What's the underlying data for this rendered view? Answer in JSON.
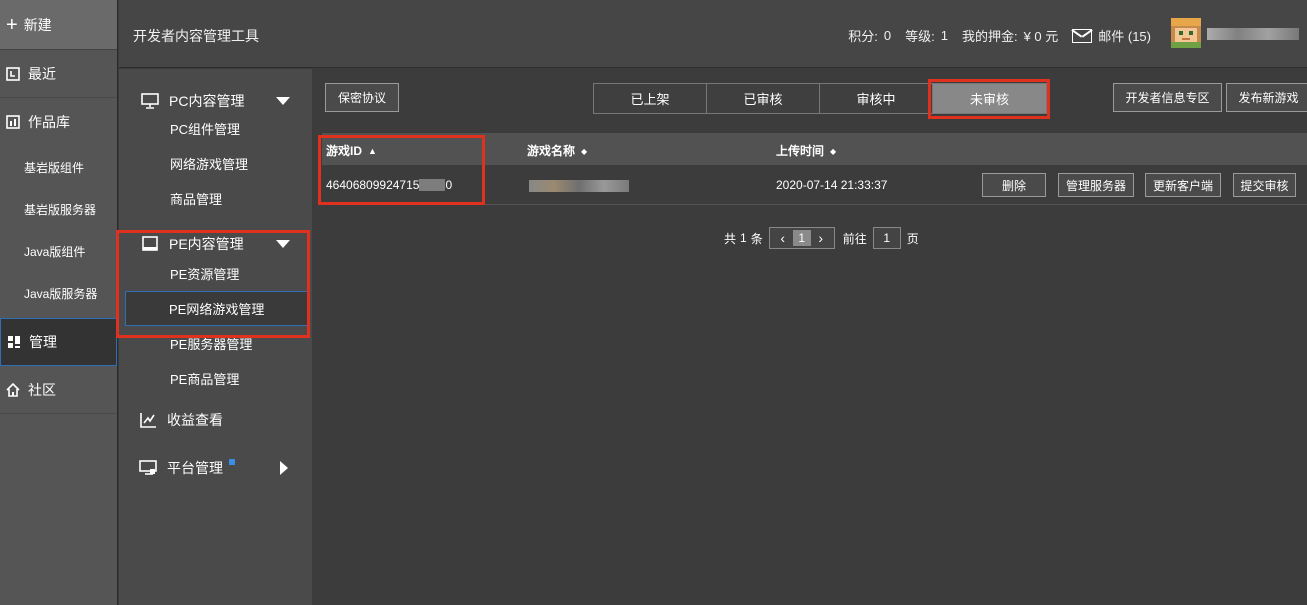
{
  "rail": {
    "new_label": "新建",
    "items": [
      {
        "label": "最近"
      },
      {
        "label": "作品库"
      }
    ],
    "subitems": [
      {
        "label": "基岩版组件"
      },
      {
        "label": "基岩版服务器"
      },
      {
        "label": "Java版组件"
      },
      {
        "label": "Java版服务器"
      }
    ],
    "manage_label": "管理",
    "community_label": "社区"
  },
  "header": {
    "title": "开发者内容管理工具",
    "points_label": "积分:",
    "points_value": "0",
    "level_label": "等级:",
    "level_value": "1",
    "deposit_label": "我的押金:",
    "deposit_value": "¥ 0 元",
    "mail_label": "邮件 (15)"
  },
  "menu": {
    "pc_section": "PC内容管理",
    "pc_items": [
      "PC组件管理",
      "网络游戏管理",
      "商品管理"
    ],
    "pe_section": "PE内容管理",
    "pe_items": [
      "PE资源管理",
      "PE网络游戏管理",
      "PE服务器管理",
      "PE商品管理"
    ],
    "revenue": "收益查看",
    "platform": "平台管理"
  },
  "main": {
    "agreement_button": "保密协议",
    "tabs": [
      "已上架",
      "已审核",
      "审核中",
      "未审核"
    ],
    "active_tab": "未审核",
    "dev_info_button": "开发者信息专区",
    "publish_button": "发布新游戏",
    "columns": [
      "游戏ID",
      "游戏名称",
      "上传时间"
    ],
    "rows": [
      {
        "id_prefix": "46406809924715",
        "id_suffix": "0",
        "upload_time": "2020-07-14 21:33:37",
        "actions": [
          "删除",
          "管理服务器",
          "更新客户端",
          "提交审核"
        ]
      }
    ],
    "pager": {
      "total_prefix": "共",
      "total_count": "1",
      "total_suffix": "条",
      "current_page": "1",
      "goto_label": "前往",
      "goto_value": "1",
      "page_suffix": "页"
    }
  },
  "colors": {
    "highlight": "#e0301e",
    "selection_border": "#2f6fb5",
    "active_tab": "#888888"
  }
}
